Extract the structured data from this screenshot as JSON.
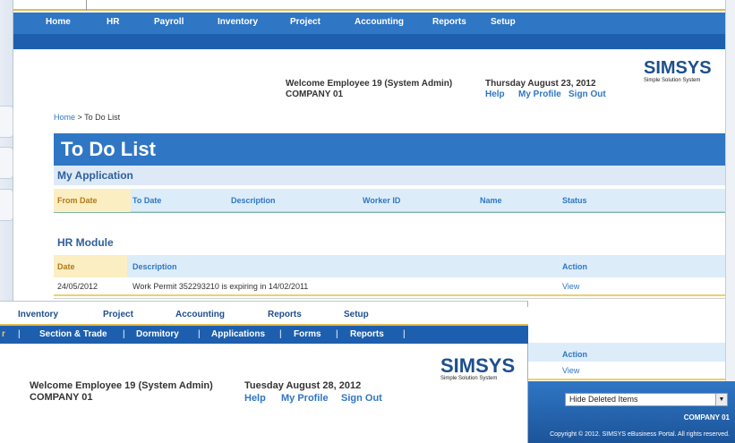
{
  "back": {
    "nav": [
      "Home",
      "HR",
      "Payroll",
      "Inventory",
      "Project",
      "Accounting",
      "Reports",
      "Setup"
    ],
    "welcome": "Welcome Employee 19 (System Admin)",
    "company": "COMPANY 01",
    "date": "Thursday August 23, 2012",
    "links": {
      "help": "Help",
      "profile": "My Profile",
      "signout": "Sign Out"
    },
    "logo": {
      "main": "SIMSYS",
      "sub": "Simple Solution System"
    },
    "breadcrumb": {
      "home": "Home",
      "sep": ">",
      "current": "To Do List"
    },
    "page_title": "To Do List",
    "my_application": {
      "title": "My Application",
      "columns": [
        "From Date",
        "To Date",
        "Description",
        "Worker ID",
        "Name",
        "Status"
      ]
    },
    "hr_module": {
      "title": "HR Module",
      "columns": [
        "Date",
        "Description",
        "Action"
      ],
      "rows": [
        {
          "date": "24/05/2012",
          "description": "Work Permit 352293210 is expiring in 14/02/2011",
          "action": "View"
        }
      ]
    },
    "lower_section": {
      "columns": [
        "Action"
      ],
      "rows": [
        {
          "action": "View"
        }
      ]
    }
  },
  "front": {
    "nav": [
      "Inventory",
      "Project",
      "Accounting",
      "Reports",
      "Setup"
    ],
    "subnav": [
      "r",
      "Section & Trade",
      "Dormitory",
      "Applications",
      "Forms",
      "Reports"
    ],
    "welcome": "Welcome Employee 19 (System Admin)",
    "company": "COMPANY 01",
    "date": "Tuesday August 28, 2012",
    "links": {
      "help": "Help",
      "profile": "My Profile",
      "signout": "Sign Out"
    },
    "logo": {
      "main": "SIMSYS",
      "sub": "Simple Solution System"
    }
  },
  "footer": {
    "select_value": "Hide Deleted Items",
    "company": "COMPANY 01",
    "copyright": "Copyright © 2012. SIMSYS eBusiness Portal. All rights reserved."
  },
  "colors": {
    "primary": "#2f76c4",
    "dark": "#1d5fae",
    "accent": "#e3b94a",
    "header_bg": "#dcedf9"
  }
}
